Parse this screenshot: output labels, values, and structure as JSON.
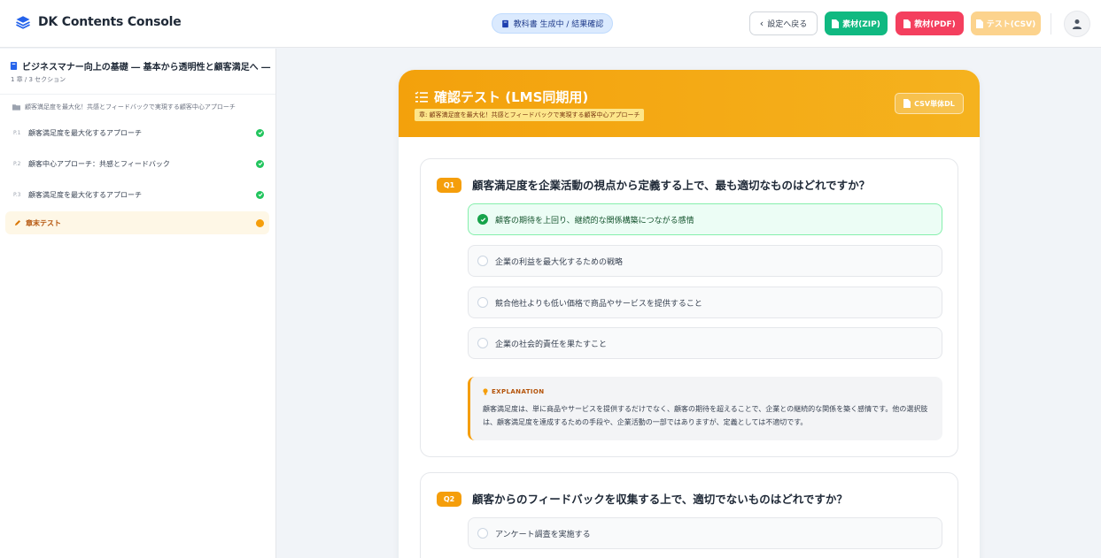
{
  "app": {
    "title": "DK Contents Console"
  },
  "header": {
    "status": "教科書 生成中 / 結果確認",
    "back_label": "設定へ戻る",
    "zip_label": "素材(ZIP)",
    "pdf_label": "教材(PDF)",
    "csv_label": "テスト(CSV)"
  },
  "sidebar": {
    "book_title": "ビジネスマナー向上の基礎 ― 基本から透明性と顧客満足へ ―",
    "book_sub": "1 章 / 3 セクション",
    "chapter": "顧客満足度を最大化！共感とフィードバックで実現する顧客中心アプローチ",
    "sections": [
      {
        "num": "P.1",
        "label": "顧客満足度を最大化するアプローチ"
      },
      {
        "num": "P.2",
        "label": "顧客中心アプローチ：共感とフィードバック"
      },
      {
        "num": "P.3",
        "label": "顧客満足度を最大化するアプローチ"
      }
    ],
    "test_label": "章末テスト"
  },
  "main": {
    "title": "確認テスト (LMS同期用)",
    "chapter_tag": "章: 顧客満足度を最大化！共感とフィードバックで実現する顧客中心アプローチ",
    "csv_button": "CSV単体DL",
    "questions": [
      {
        "badge": "Q1",
        "text": "顧客満足度を企業活動の視点から定義する上で、最も適切なものはどれですか？",
        "options": [
          "顧客の期待を上回り、継続的な関係構築につながる感情",
          "企業の利益を最大化するための戦略",
          "競合他社よりも低い価格で商品やサービスを提供すること",
          "企業の社会的責任を果たすこと"
        ],
        "explanation_label": "EXPLANATION",
        "explanation": "顧客満足度は、単に商品やサービスを提供するだけでなく、顧客の期待を超えることで、企業との継続的な関係を築く感情です。他の選択肢は、顧客満足度を達成するための手段や、企業活動の一部ではありますが、定義としては不適切です。"
      },
      {
        "badge": "Q2",
        "text": "顧客からのフィードバックを収集する上で、適切でないものはどれですか？",
        "options": [
          "アンケート調査を実施する"
        ]
      }
    ]
  },
  "colors": {
    "accent": "#f59e0b",
    "correct": "#16a34a",
    "zip": "#10b981",
    "pdf": "#f43f5e"
  }
}
